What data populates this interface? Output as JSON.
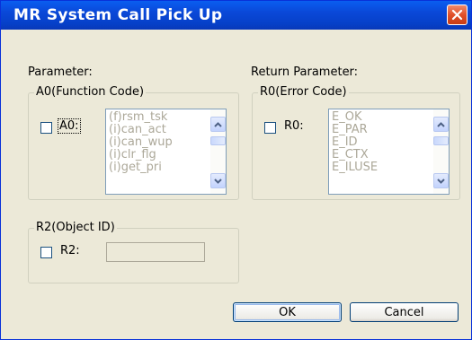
{
  "window": {
    "title": "MR System Call Pick Up"
  },
  "parameter": {
    "heading": "Parameter:",
    "a0_group": {
      "legend": "A0(Function Code)",
      "checkbox_label": "A0:",
      "list_items": [
        "(f)rsm_tsk",
        "(i)can_act",
        "(i)can_wup",
        "(i)clr_flg",
        "(i)get_pri"
      ]
    },
    "r2_group": {
      "legend": "R2(Object ID)",
      "checkbox_label": "R2:",
      "value": ""
    }
  },
  "return_parameter": {
    "heading": "Return Parameter:",
    "r0_group": {
      "legend": "R0(Error Code)",
      "checkbox_label": "R0:",
      "list_items": [
        "E_OK",
        "E_PAR",
        "E_ID",
        "E_CTX",
        "E_ILUSE"
      ]
    }
  },
  "buttons": {
    "ok": "OK",
    "cancel": "Cancel"
  },
  "colors": {
    "title_bar": "#0a48d8",
    "dialog_bg": "#ece9d8",
    "close_button": "#e0502a",
    "disabled_text": "#aca899"
  },
  "icons": {
    "close": "close-icon",
    "scroll_up": "chevron-up-icon",
    "scroll_down": "chevron-down-icon"
  }
}
